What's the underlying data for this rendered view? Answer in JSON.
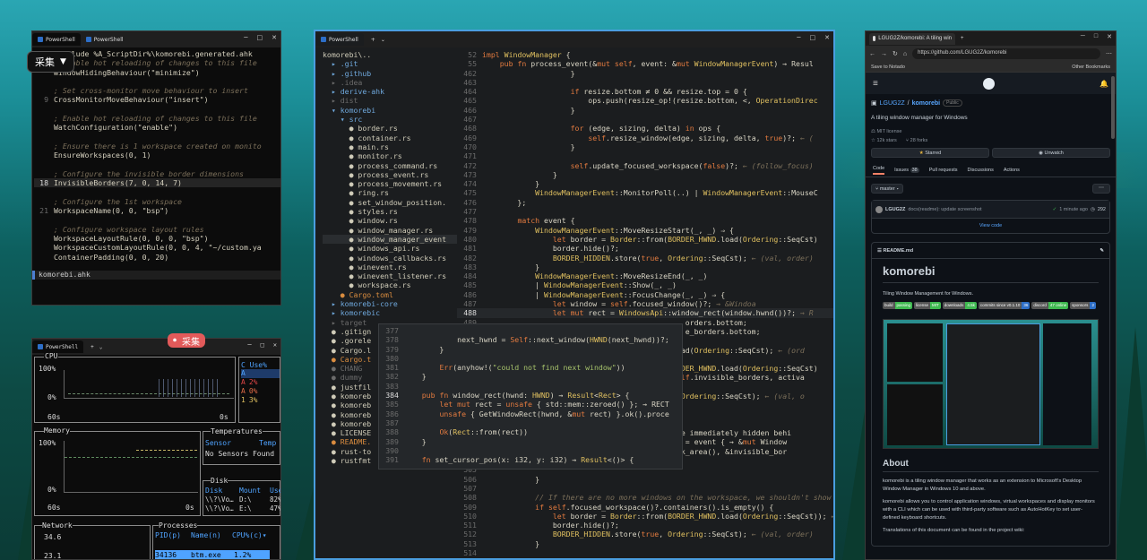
{
  "colors": {
    "accent": "#2d6ec7",
    "pill_red": "#e25a5a",
    "term_bg": "#0c0c0c",
    "code_bg": "#1b1d1f",
    "gh_bg": "#0d1117"
  },
  "icons": [
    "powershell-icon",
    "chevron-down-icon",
    "minimize-icon",
    "maximize-icon",
    "close-icon",
    "github-logo-icon",
    "star-icon",
    "folder-icon",
    "file-icon"
  ],
  "pills": {
    "top": "采集",
    "mid": "采集"
  },
  "ahk": {
    "tabs": [
      "PowerShell",
      "PowerShell"
    ],
    "lines": [
      {
        "n": "",
        "t": "#include %A_ScriptDir%\\komorebi.generated.ahk",
        "c": false
      },
      {
        "n": "",
        "t": "; Enable hot reloading of changes to this file",
        "c": true
      },
      {
        "n": "",
        "t": "WindowHidingBehaviour(\"minimize\")",
        "c": false
      },
      {
        "n": "",
        "t": "",
        "c": false
      },
      {
        "n": "",
        "t": "; Set cross-monitor move behaviour to insert",
        "c": true
      },
      {
        "n": "9",
        "t": "CrossMonitorMoveBehaviour(\"insert\")",
        "c": false
      },
      {
        "n": "",
        "t": "",
        "c": false
      },
      {
        "n": "",
        "t": "; Enable hot reloading of changes to this file",
        "c": true
      },
      {
        "n": "",
        "t": "WatchConfiguration(\"enable\")",
        "c": false
      },
      {
        "n": "",
        "t": "",
        "c": false
      },
      {
        "n": "",
        "t": "; Ensure there is 1 workspace created on monito",
        "c": true
      },
      {
        "n": "",
        "t": "EnsureWorkspaces(0, 1)",
        "c": false
      },
      {
        "n": "",
        "t": "",
        "c": false
      },
      {
        "n": "",
        "t": "; Configure the invisible border dimensions",
        "c": true
      },
      {
        "n": "18",
        "t": "InvisibleBorders(7, 0, 14, 7)",
        "c": false
      },
      {
        "n": "",
        "t": "",
        "c": false
      },
      {
        "n": "",
        "t": "; Configure the 1st workspace",
        "c": true
      },
      {
        "n": "21",
        "t": "WorkspaceName(0, 0, \"bsp\")",
        "c": false
      },
      {
        "n": "",
        "t": "",
        "c": false
      },
      {
        "n": "",
        "t": "; Configure workspace layout rules",
        "c": true
      },
      {
        "n": "",
        "t": "WorkspaceLayoutRule(0, 0, 0, \"bsp\")",
        "c": false
      },
      {
        "n": "",
        "t": "WorkspaceCustomLayoutRule(0, 0, 4, \"~/custom.ya",
        "c": false
      },
      {
        "n": "",
        "t": "ContainerPadding(0, 0, 20)",
        "c": false
      }
    ],
    "status": "komorebi.ahk"
  },
  "btm": {
    "tab": "PowerShell",
    "cpu_label": "CPU",
    "cpu_100": "100%",
    "cpu_0": "0%",
    "cpu_60s": "60s",
    "cpu_0s": "0s",
    "cpu_col_head": "C Use%",
    "cpu_vals": [
      [
        "A",
        ""
      ],
      [
        "A",
        "2%"
      ],
      [
        "A",
        "0%"
      ],
      [
        "1",
        "3%"
      ]
    ],
    "mem_label": "Memory",
    "mem_100": "100%",
    "mem_0": "0%",
    "mem_60s": "60s",
    "mem_0s": "0s",
    "temps_label": "Temperatures",
    "temps_head_sensor": "Sensor",
    "temps_head_temp": "Temp",
    "temps_none": "No Sensors Found",
    "disk_label": "Disk",
    "disk_heads": [
      "Disk",
      "Mount",
      "Used"
    ],
    "disks": [
      [
        "\\\\?\\Vo…",
        "D:\\",
        "82%"
      ],
      [
        "\\\\?\\Vo…",
        "E:\\",
        "47%"
      ]
    ],
    "net_label": "Network",
    "net_vals": [
      "34.6",
      "23.1"
    ],
    "proc_label": "Processes",
    "proc_heads": [
      "PID(p)",
      "Name(n)",
      "CPU%(c)▾"
    ],
    "proc_row": [
      "34136",
      "btm.exe",
      "1.2%"
    ]
  },
  "editor": {
    "tab": "PowerShell",
    "tree": [
      "komorebi\\..",
      "  ▸ .git",
      "  ▸ .github",
      "  ▸ .idea",
      "  ▸ derive-ahk",
      "  ▸ dist",
      "  ▾ komorebi",
      "    ▾ src",
      "      ● border.rs",
      "      ● container.rs",
      "      ● main.rs",
      "      ● monitor.rs",
      "      ● process_command.rs",
      "      ● process_event.rs",
      "      ● process_movement.rs",
      "      ● ring.rs",
      "      ● set_window_position.",
      "      ● styles.rs",
      "      ● window.rs",
      "      ● window_manager.rs",
      "      ● window_manager_event",
      "      ● windows_api.rs",
      "      ● windows_callbacks.rs",
      "      ● winevent.rs",
      "      ● winevent_listener.rs",
      "      ● workspace.rs",
      "    ● Cargo.toml",
      "  ▸ komorebi-core",
      "  ▸ komorebic",
      "  ▸ target",
      "  ● .gitign",
      "  ● .gorele",
      "  ● Cargo.l",
      "  ● Cargo.t",
      "  ● CHANG",
      "  ● dummy",
      "  ● justfil",
      "  ● komoreb",
      "  ● komoreb",
      "  ● komoreb",
      "  ● komoreb",
      "  ● LICENSE",
      "  ● README.",
      "  ● rust-to",
      "  ● rustfmt"
    ],
    "lines": [
      {
        "n": "52",
        "t": "impl WindowManager {"
      },
      {
        "n": "55",
        "t": "    pub fn process_event(&mut self, event: &mut WindowManagerEvent) → Resul"
      },
      {
        "n": "462",
        "t": "                    }"
      },
      {
        "n": "463",
        "t": ""
      },
      {
        "n": "464",
        "t": "                    if resize.bottom ≠ 0 && resize.top = 0 {"
      },
      {
        "n": "465",
        "t": "                        ops.push(resize_op!(resize.bottom, <, OperationDirec"
      },
      {
        "n": "466",
        "t": "                    }"
      },
      {
        "n": "467",
        "t": ""
      },
      {
        "n": "468",
        "t": "                    for (edge, sizing, delta) in ops {"
      },
      {
        "n": "469",
        "t": "                        self.resize_window(edge, sizing, delta, true)?; ← ("
      },
      {
        "n": "470",
        "t": "                    }"
      },
      {
        "n": "471",
        "t": ""
      },
      {
        "n": "472",
        "t": "                    self.update_focused_workspace(false)?; ← (follow_focus)"
      },
      {
        "n": "473",
        "t": "                }"
      },
      {
        "n": "474",
        "t": "            }"
      },
      {
        "n": "475",
        "t": "            WindowManagerEvent::MonitorPoll(..) | WindowManagerEvent::MouseC"
      },
      {
        "n": "476",
        "t": "        };"
      },
      {
        "n": "477",
        "t": ""
      },
      {
        "n": "478",
        "t": "        match event {"
      },
      {
        "n": "479",
        "t": "            WindowManagerEvent::MoveResizeStart(_, _) ⇒ {"
      },
      {
        "n": "480",
        "t": "                let border = Border::from(BORDER_HWND.load(Ordering::SeqCst)"
      },
      {
        "n": "481",
        "t": "                border.hide()?;"
      },
      {
        "n": "482",
        "t": "                BORDER_HIDDEN.store(true, Ordering::SeqCst); ← (val, order)"
      },
      {
        "n": "483",
        "t": "            }"
      },
      {
        "n": "484",
        "t": "            WindowManagerEvent::MoveResizeEnd(_, _)"
      },
      {
        "n": "485",
        "t": "            | WindowManagerEvent::Show(_, _)"
      },
      {
        "n": "486",
        "t": "            | WindowManagerEvent::FocusChange(_, _) ⇒ {"
      },
      {
        "n": "487",
        "t": "                let window = self.focused_window()?; → &Windoa"
      },
      {
        "n": "488",
        "t": "                let mut rect = WindowsApi::window_rect(window.hwnd())?; → R"
      },
      {
        "n": "489",
        "t": "                                              orders.bottom;"
      },
      {
        "n": "490",
        "t": "                                              e_borders.bottom;"
      },
      {
        "n": "491",
        "t": ""
      },
      {
        "n": "492",
        "t": "                                          .load(Ordering::SeqCst); ← (ord"
      },
      {
        "n": "493",
        "t": ""
      },
      {
        "n": "494",
        "t": "                                          BORDER_HWND.load(Ordering::SeqCst)"
      },
      {
        "n": "495",
        "t": "                                          &self.invisible_borders, activa"
      },
      {
        "n": "496",
        "t": ""
      },
      {
        "n": "497",
        "t": "                                          e, Ordering::SeqCst); ← (val, o"
      },
      {
        "n": "498",
        "t": ""
      },
      {
        "n": "499",
        "t": ""
      },
      {
        "n": "500",
        "t": ""
      },
      {
        "n": "501",
        "t": "                                      ldn't be immediately hidden behi"
      },
      {
        "n": "502",
        "t": "                                      window) = event { → &mut Window"
      },
      {
        "n": "503",
        "t": "                                      tor_work_area(), &invisible_bor"
      },
      {
        "n": "504",
        "t": ""
      },
      {
        "n": "505",
        "t": ""
      },
      {
        "n": "506",
        "t": "            }"
      },
      {
        "n": "507",
        "t": ""
      },
      {
        "n": "508",
        "t": "            // If there are no more windows on the workspace, we shouldn't show"
      },
      {
        "n": "509",
        "t": "            if self.focused_workspace()?.containers().is_empty() {"
      },
      {
        "n": "510",
        "t": "                let border = Border::from(BORDER_HWND.load(Ordering::SeqCst)); ←"
      },
      {
        "n": "511",
        "t": "                border.hide()?;"
      },
      {
        "n": "512",
        "t": "                BORDER_HIDDEN.store(true, Ordering::SeqCst); ← (val, order)"
      },
      {
        "n": "513",
        "t": "            }"
      },
      {
        "n": "514",
        "t": ""
      }
    ],
    "popup": [
      {
        "n": "377",
        "t": ""
      },
      {
        "n": "378",
        "t": "            next_hwnd = Self::next_window(HWND(next_hwnd))?;"
      },
      {
        "n": "379",
        "t": "        }"
      },
      {
        "n": "380",
        "t": ""
      },
      {
        "n": "381",
        "t": "        Err(anyhow!(\"could not find next window\"))"
      },
      {
        "n": "382",
        "t": "    }"
      },
      {
        "n": "383",
        "t": ""
      },
      {
        "n": "384",
        "t": "    pub fn window_rect(hwnd: HWND) → Result<Rect> {"
      },
      {
        "n": "385",
        "t": "        let mut rect = unsafe { std::mem::zeroed() }; → RECT"
      },
      {
        "n": "386",
        "t": "        unsafe { GetWindowRect(hwnd, &mut rect) }.ok().proce"
      },
      {
        "n": "387",
        "t": ""
      },
      {
        "n": "388",
        "t": "        Ok(Rect::from(rect))"
      },
      {
        "n": "389",
        "t": "    }"
      },
      {
        "n": "390",
        "t": ""
      },
      {
        "n": "391",
        "t": "    fn set_cursor_pos(x: i32, y: i32) → Result<()> {"
      }
    ]
  },
  "browser": {
    "tab_title": "LGUG2Z/komorebi: A tiling win",
    "url": "https://github.com/LGUG2Z/komorebi",
    "bookmark": "Save to Notado",
    "other_bookmarks": "Other Bookmarks",
    "owner": "LGUG2Z",
    "repo": "komorebi",
    "public": "Public",
    "desc": "A tiling window manager for Windows",
    "license": "MIT license",
    "stars": "12k stars",
    "forks": "28 forks",
    "starred_btn": "Starred",
    "unwatch_btn": "Unwatch",
    "nav": [
      "Code",
      "Issues",
      "Pull requests",
      "Discussions",
      "Actions"
    ],
    "issues_count": "38",
    "branch": "master",
    "commit_user": "LGUG2Z",
    "commit_msg": "docs(readme): update screenshot",
    "commit_time": "1 minute ago",
    "commit_count": "292",
    "view_code": "View code",
    "readme_file": "README.md",
    "readme_title": "komorebi",
    "readme_sub": "Tiling Window Management for Windows.",
    "badges": [
      [
        "build",
        "passing",
        "#3fb950"
      ],
      [
        "license",
        "MIT",
        "#3fb950"
      ],
      [
        "downloads",
        "4.5k",
        "#3fb950"
      ],
      [
        "commits since v0.1.10",
        "36",
        "#2d6ec7"
      ],
      [
        "discord",
        "47 online",
        "#3fb950"
      ],
      [
        "sponsors",
        "2",
        "#2d6ec7"
      ]
    ],
    "about": "About",
    "p1": "komorebi is a tiling window manager that works as an extension to Microsoft's Desktop Window Manager in Windows 10 and above.",
    "p2": "komorebi allows you to control application windows, virtual workspaces and display monitors with a CLI which can be used with third-party software such as AutoHotKey to set user-defined keyboard shortcuts.",
    "p3": "Translations of this document can be found in the project wiki:"
  }
}
